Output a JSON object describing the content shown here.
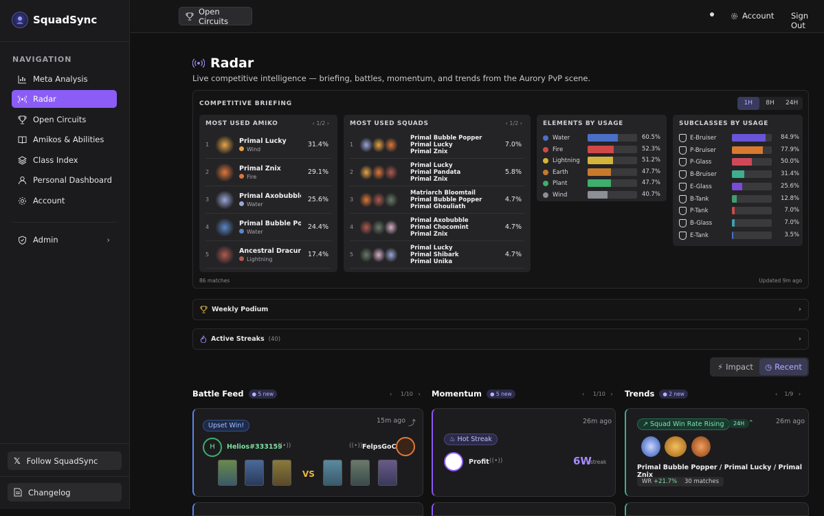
{
  "app": {
    "title": "SquadSync"
  },
  "sidebar": {
    "heading": "NAVIGATION",
    "items": [
      {
        "label": "Meta Analysis",
        "icon": "bar-chart-icon"
      },
      {
        "label": "Radar",
        "icon": "radar-icon",
        "active": true
      },
      {
        "label": "Open Circuits",
        "icon": "trophy-icon"
      },
      {
        "label": "Amikos & Abilities",
        "icon": "book-icon"
      },
      {
        "label": "Class Index",
        "icon": "layers-icon"
      },
      {
        "label": "Personal Dashboard",
        "icon": "user-icon"
      },
      {
        "label": "Account",
        "icon": "gear-icon"
      }
    ],
    "admin": "Admin",
    "follow": "Follow SquadSync",
    "changelog": "Changelog"
  },
  "topbar": {
    "open_circuits": "Open Circuits",
    "account": "Account",
    "sign_out": "Sign Out"
  },
  "page": {
    "title": "Radar",
    "subtitle": "Live competitive intelligence — briefing, battles, momentum, and trends from the Aurory PvP scene."
  },
  "briefing": {
    "title": "COMPETITIVE BRIEFING",
    "timeframes": [
      "1H",
      "8H",
      "24H"
    ],
    "active_timeframe": "1H",
    "matches": "86 matches",
    "updated": "Updated 9m ago",
    "amiko": {
      "title": "MOST USED AMIKO",
      "page": "1/2",
      "rows": [
        {
          "rank": "1",
          "name": "Primal Lucky",
          "element": "Wind",
          "pct": "31.4%",
          "color": "#e8a447"
        },
        {
          "rank": "2",
          "name": "Primal Znix",
          "element": "Fire",
          "pct": "29.1%",
          "color": "#e0773a"
        },
        {
          "rank": "3",
          "name": "Primal Axobubble",
          "element": "Water",
          "pct": "25.6%",
          "color": "#9aa7d8"
        },
        {
          "rank": "4",
          "name": "Primal Bubble Popper",
          "element": "Water",
          "pct": "24.4%",
          "color": "#5a86c8"
        },
        {
          "rank": "5",
          "name": "Ancestral Dracurve",
          "element": "Lightning",
          "pct": "17.4%",
          "color": "#b05a50"
        }
      ]
    },
    "squads": {
      "title": "MOST USED SQUADS",
      "page": "1/2",
      "rows": [
        {
          "rank": "1",
          "members": [
            "Primal Bubble Popper",
            "Primal Lucky",
            "Primal Znix"
          ],
          "pct": "7.0%"
        },
        {
          "rank": "2",
          "members": [
            "Primal Lucky",
            "Primal Pandata",
            "Primal Znix"
          ],
          "pct": "5.8%"
        },
        {
          "rank": "3",
          "members": [
            "Matriarch Bloomtail",
            "Primal Bubble Popper",
            "Primal Ghouliath"
          ],
          "pct": "4.7%"
        },
        {
          "rank": "4",
          "members": [
            "Primal Axobubble",
            "Primal Chocomint",
            "Primal Znix"
          ],
          "pct": "4.7%"
        },
        {
          "rank": "5",
          "members": [
            "Primal Lucky",
            "Primal Shibark",
            "Primal Unika"
          ],
          "pct": "4.7%"
        }
      ]
    },
    "elements": {
      "title": "ELEMENTS BY USAGE",
      "rows": [
        {
          "name": "Water",
          "value": 60.5,
          "label": "60.5%",
          "color": "#4a6fc8"
        },
        {
          "name": "Fire",
          "value": 52.3,
          "label": "52.3%",
          "color": "#d04848"
        },
        {
          "name": "Lightning",
          "value": 51.2,
          "label": "51.2%",
          "color": "#d4b43a"
        },
        {
          "name": "Earth",
          "value": 47.7,
          "label": "47.7%",
          "color": "#c77a2c"
        },
        {
          "name": "Plant",
          "value": 47.7,
          "label": "47.7%",
          "color": "#3fae6e"
        },
        {
          "name": "Wind",
          "value": 40.7,
          "label": "40.7%",
          "color": "#8e8e96"
        }
      ]
    },
    "subclasses": {
      "title": "SUBCLASSES BY USAGE",
      "rows": [
        {
          "name": "E-Bruiser",
          "value": 84.9,
          "label": "84.9%",
          "color": "#6a55d8"
        },
        {
          "name": "P-Bruiser",
          "value": 77.9,
          "label": "77.9%",
          "color": "#d87a30"
        },
        {
          "name": "P-Glass",
          "value": 50.0,
          "label": "50.0%",
          "color": "#d04858"
        },
        {
          "name": "B-Bruiser",
          "value": 31.4,
          "label": "31.4%",
          "color": "#3fae8e"
        },
        {
          "name": "E-Glass",
          "value": 25.6,
          "label": "25.6%",
          "color": "#7a4ad8"
        },
        {
          "name": "B-Tank",
          "value": 12.8,
          "label": "12.8%",
          "color": "#3f9e6e"
        },
        {
          "name": "P-Tank",
          "value": 7.0,
          "label": "7.0%",
          "color": "#d04848"
        },
        {
          "name": "B-Glass",
          "value": 7.0,
          "label": "7.0%",
          "color": "#3f9eb0"
        },
        {
          "name": "E-Tank",
          "value": 3.5,
          "label": "3.5%",
          "color": "#4a6fc8"
        }
      ]
    }
  },
  "weekly_podium": "Weekly Podium",
  "active_streaks": {
    "label": "Active Streaks",
    "count": "(40)"
  },
  "sort": {
    "impact": "Impact",
    "recent": "Recent"
  },
  "battle_feed": {
    "title": "Battle Feed",
    "badge": "5 new",
    "page": "1/10",
    "tag": "Upset Win!",
    "ago": "15m ago",
    "winner": "Helios#333159",
    "winner_initial": "H",
    "vs": "VS",
    "opponent": "FelpsGoC"
  },
  "momentum": {
    "title": "Momentum",
    "badge": "5 new",
    "page": "1/10",
    "tag": "Hot Streak",
    "ago": "26m ago",
    "player": "Profit",
    "streak": "6W",
    "streak_label": "streak"
  },
  "trends": {
    "title": "Trends",
    "badge": "2 new",
    "page": "1/9",
    "tag": "Squad Win Rate Rising",
    "window": "24H",
    "ago": "26m ago",
    "squad": "Primal Bubble Popper / Primal Lucky / Primal Znix",
    "wr_label": "WR",
    "wr": "+21.7%",
    "matches": "30 matches"
  }
}
